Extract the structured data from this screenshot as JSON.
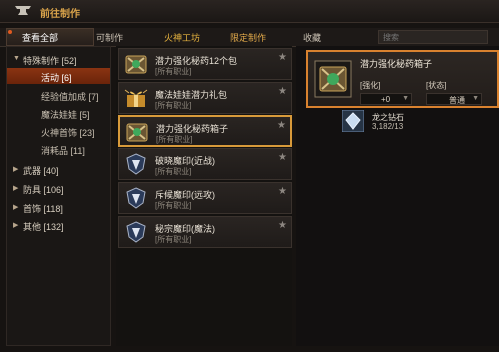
{
  "title": "前往制作",
  "tabs": [
    {
      "label": "查看全部"
    },
    {
      "label": "可制作"
    },
    {
      "label": "火神工坊"
    },
    {
      "label": "限定制作"
    },
    {
      "label": "收藏"
    }
  ],
  "search": {
    "placeholder": "搜索"
  },
  "categories": [
    {
      "label": "特殊制作 [52]"
    },
    {
      "label": "活动 [6]"
    },
    {
      "label": "经验值加成 [7]"
    },
    {
      "label": "魔法娃娃 [5]"
    },
    {
      "label": "火神首饰 [23]"
    },
    {
      "label": "消耗品 [11]"
    },
    {
      "label": "武器 [40]"
    },
    {
      "label": "防具 [106]"
    },
    {
      "label": "首饰 [118]"
    },
    {
      "label": "其他 [132]"
    }
  ],
  "items": [
    {
      "name": "潜力强化秘药12个包",
      "sub": "[所有职业]"
    },
    {
      "name": "魔法娃娃潜力礼包",
      "sub": "[所有职业]"
    },
    {
      "name": "潜力强化秘药箱子",
      "sub": "[所有职业]"
    },
    {
      "name": "破晓魔印(近战)",
      "sub": "[所有职业]"
    },
    {
      "name": "斥候魔印(远攻)",
      "sub": "[所有职业]"
    },
    {
      "name": "秘宗魔印(魔法)",
      "sub": "[所有职业]"
    }
  ],
  "detail": {
    "name": "潜力强化秘药箱子",
    "enhance_label": "[强化]",
    "enhance_value": "+0",
    "status_label": "[状态]",
    "status_value": "普通"
  },
  "material": {
    "name": "龙之钻石",
    "quantity": "3,182/13"
  },
  "colors": {
    "accent": "#d9822f",
    "selected": "#8a3412",
    "gold_tab": "#e7b43f"
  }
}
